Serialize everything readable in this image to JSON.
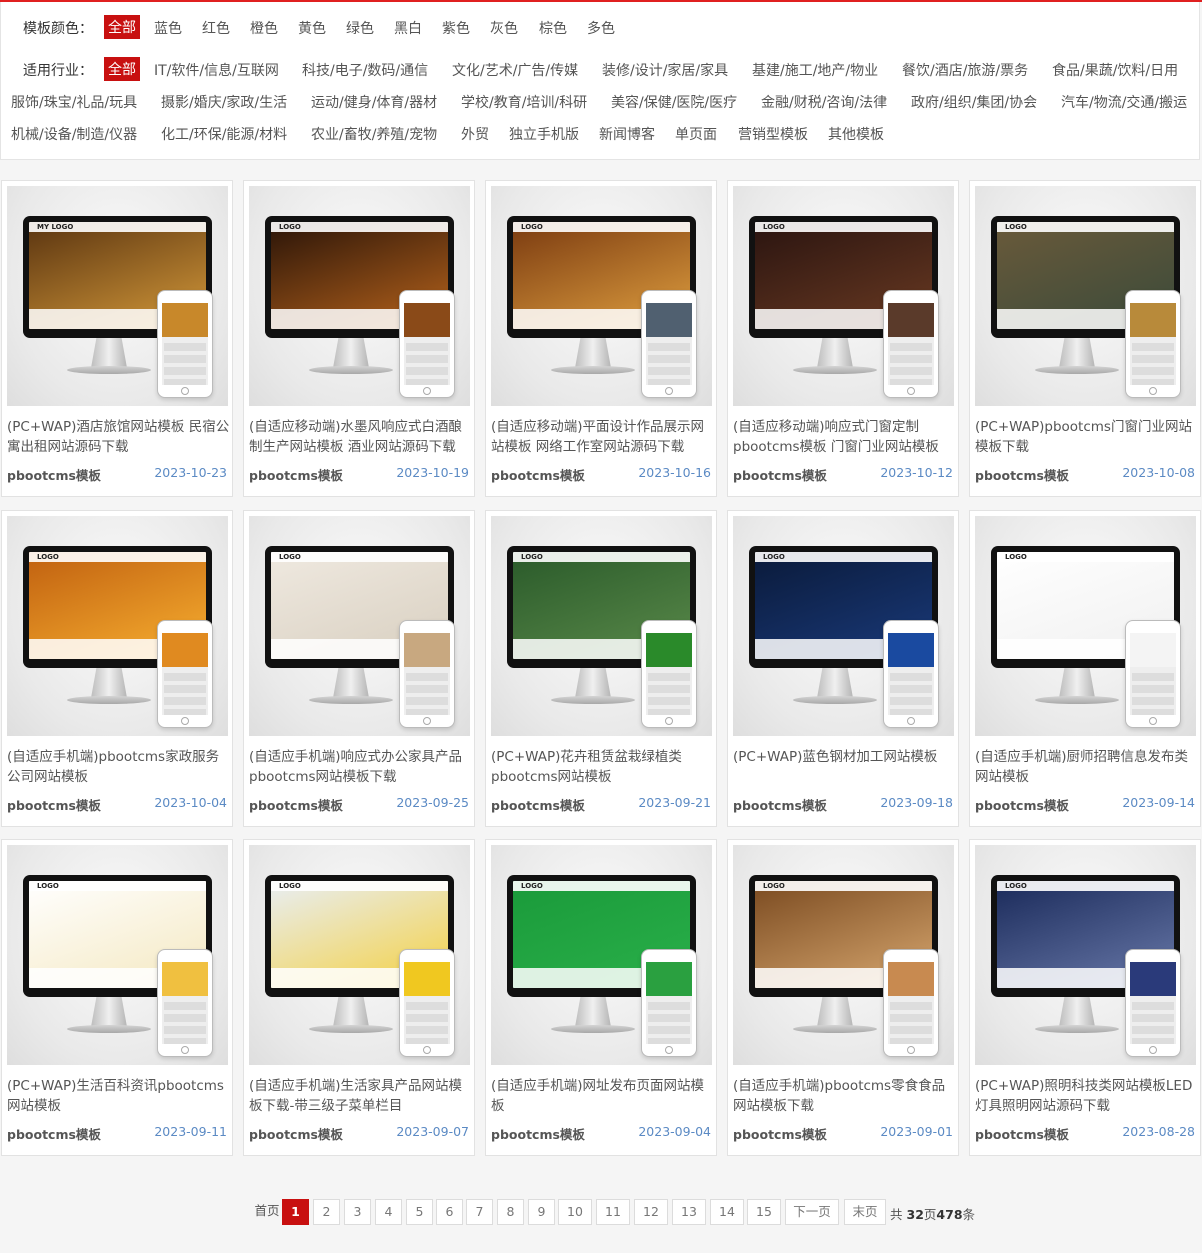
{
  "filters": {
    "color_label": "模板颜色：",
    "colors": [
      "全部",
      "蓝色",
      "红色",
      "橙色",
      "黄色",
      "绿色",
      "黑白",
      "紫色",
      "灰色",
      "棕色",
      "多色"
    ],
    "industry_label": "适用行业：",
    "industries_row1": [
      "全部",
      "IT/软件/信息/互联网",
      "科技/电子/数码/通信",
      "文化/艺术/广告/传媒",
      "装修/设计/家居/家具",
      "基建/施工/地产/物业",
      "餐饮/酒店/旅游/票务",
      "食品/果蔬/饮料/日用"
    ],
    "industries_row2": [
      "服饰/珠宝/礼品/玩具",
      "摄影/婚庆/家政/生活",
      "运动/健身/体育/器材",
      "学校/教育/培训/科研",
      "美容/保健/医院/医疗",
      "金融/财税/咨询/法律",
      "政府/组织/集团/协会",
      "汽车/物流/交通/搬运"
    ],
    "industries_row3": [
      "机械/设备/制造/仪器",
      "化工/环保/能源/材料",
      "农业/畜牧/养殖/宠物",
      "外贸",
      "独立手机版",
      "新闻博客",
      "单页面",
      "营销型模板",
      "其他模板"
    ]
  },
  "templates": [
    {
      "title": "(PC+WAP)酒店旅馆网站模板 民宿公寓出租网站源码下载",
      "source": "pbootcms模板",
      "date": "2023-10-23",
      "logo": "MY LOGO",
      "screen": [
        "#5a3410",
        "#d59a3a"
      ],
      "phone": "#c8882a"
    },
    {
      "title": "(自适应移动端)水墨风响应式白酒酿制生产网站模板 酒业网站源码下载",
      "source": "pbootcms模板",
      "date": "2023-10-19",
      "logo": "LOGO",
      "screen": [
        "#2a1408",
        "#b8641c"
      ],
      "phone": "#8a4a18"
    },
    {
      "title": "(自适应移动端)平面设计作品展示网站模板 网络工作室网站源码下载",
      "source": "pbootcms模板",
      "date": "2023-10-16",
      "logo": "LOGO",
      "screen": [
        "#7a3a10",
        "#e0a040"
      ],
      "phone": "#506070"
    },
    {
      "title": "(自适应移动端)响应式门窗定制pbootcms模板 门窗门业网站模板",
      "source": "pbootcms模板",
      "date": "2023-10-12",
      "logo": "LOGO",
      "screen": [
        "#2a1410",
        "#6a3a22"
      ],
      "phone": "#5a3a2a"
    },
    {
      "title": "(PC+WAP)pbootcms门窗门业网站模板下载",
      "source": "pbootcms模板",
      "date": "2023-10-08",
      "logo": "LOGO",
      "screen": [
        "#6a5a3a",
        "#3a4a3a"
      ],
      "phone": "#b88a3a"
    },
    {
      "title": "(自适应手机端)pbootcms家政服务公司网站模板",
      "source": "pbootcms模板",
      "date": "2023-10-04",
      "logo": "LOGO",
      "screen": [
        "#c06010",
        "#f8b030"
      ],
      "phone": "#e08a20"
    },
    {
      "title": "(自适应手机端)响应式办公家具产品pbootcms网站模板下载",
      "source": "pbootcms模板",
      "date": "2023-09-25",
      "logo": "LOGO",
      "screen": [
        "#efe9e0",
        "#d8cfc0"
      ],
      "phone": "#c8a880"
    },
    {
      "title": "(PC+WAP)花卉租赁盆栽绿植类pbootcms网站模板",
      "source": "pbootcms模板",
      "date": "2023-09-21",
      "logo": "LOGO",
      "screen": [
        "#2a5a2a",
        "#5a8a4a"
      ],
      "phone": "#2a8a2a"
    },
    {
      "title": "(PC+WAP)蓝色钢材加工网站模板",
      "source": "pbootcms模板",
      "date": "2023-09-18",
      "logo": "LOGO",
      "screen": [
        "#0a1a3a",
        "#1a3a7a"
      ],
      "phone": "#1a4aa0"
    },
    {
      "title": "(自适应手机端)厨师招聘信息发布类网站模板",
      "source": "pbootcms模板",
      "date": "2023-09-14",
      "logo": "LOGO",
      "screen": [
        "#ffffff",
        "#f0f0f0"
      ],
      "phone": "#f4f4f4"
    },
    {
      "title": "(PC+WAP)生活百科资讯pbootcms网站模板",
      "source": "pbootcms模板",
      "date": "2023-09-11",
      "logo": "LOGO",
      "screen": [
        "#ffffff",
        "#f4e8c0"
      ],
      "phone": "#f0c040"
    },
    {
      "title": "(自适应手机端)生活家具产品网站模板下载-带三级子菜单栏目",
      "source": "pbootcms模板",
      "date": "2023-09-07",
      "logo": "LOGO",
      "screen": [
        "#e8eef4",
        "#f4d040"
      ],
      "phone": "#f0c820"
    },
    {
      "title": "(自适应手机端)网址发布页面网站模板",
      "source": "pbootcms模板",
      "date": "2023-09-04",
      "logo": "LOGO",
      "screen": [
        "#1a9a3a",
        "#2ab04a"
      ],
      "phone": "#2aa040"
    },
    {
      "title": "(自适应手机端)pbootcms零食食品网站模板下载",
      "source": "pbootcms模板",
      "date": "2023-09-01",
      "logo": "LOGO",
      "screen": [
        "#7a4a20",
        "#d8a870"
      ],
      "phone": "#c88a50"
    },
    {
      "title": "(PC+WAP)照明科技类网站模板LED灯具照明网站源码下载",
      "source": "pbootcms模板",
      "date": "2023-08-28",
      "logo": "LOGO",
      "screen": [
        "#1a2a5a",
        "#6a7aaa"
      ],
      "phone": "#2a3a7a"
    }
  ],
  "pagination": {
    "first": "首页",
    "pages": [
      "1",
      "2",
      "3",
      "4",
      "5",
      "6",
      "7",
      "8",
      "9",
      "10",
      "11",
      "12",
      "13",
      "14",
      "15"
    ],
    "current": "1",
    "next": "下一页",
    "last": "末页",
    "total_prefix": "共",
    "total_pages": "32",
    "total_mid": "页",
    "total_items": "478",
    "total_suffix": "条"
  },
  "colors": {
    "accent": "#c81010",
    "date": "#5b8ac4"
  }
}
